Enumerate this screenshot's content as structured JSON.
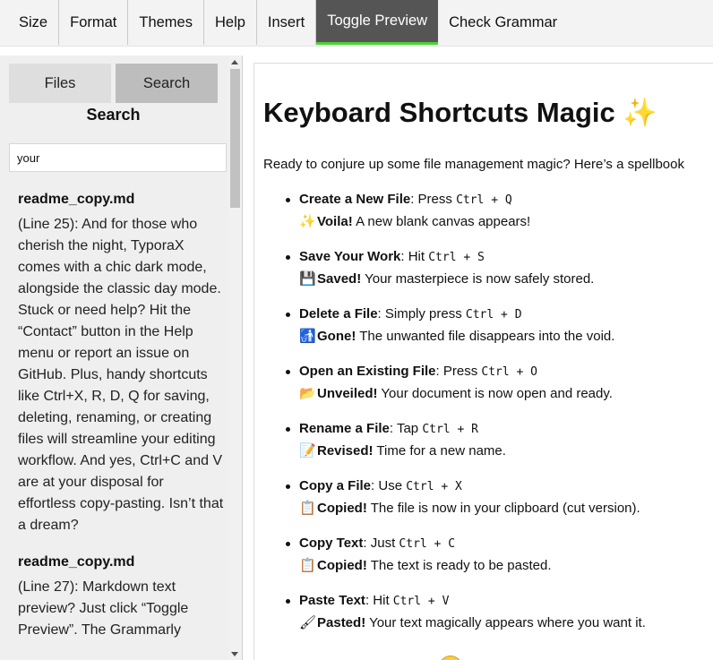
{
  "menu": {
    "items": [
      {
        "label": "Size"
      },
      {
        "label": "Format"
      },
      {
        "label": "Themes"
      },
      {
        "label": "Help"
      },
      {
        "label": "Insert"
      },
      {
        "label": "Toggle Preview",
        "active": true
      },
      {
        "label": "Check Grammar"
      }
    ],
    "active_color": "#555555",
    "active_underline_color": "#4cd137"
  },
  "sidebar": {
    "tabs": [
      {
        "label": "Files"
      },
      {
        "label": "Search",
        "active": true
      }
    ],
    "title": "Search",
    "search_value": "your",
    "results": [
      {
        "file": "readme_copy.md",
        "snippet": "(Line 25): And for those who cherish the night, TyporaX comes with a chic dark mode, alongside the classic day mode. Stuck or need help? Hit the “Contact” button in the Help menu or report an issue on GitHub. Plus, handy shortcuts like Ctrl+X, R, D, Q for saving, deleting, renaming, or creating files will streamline your editing workflow. And yes, Ctrl+C and V are at your disposal for effortless copy-pasting. Isn’t that a dream?"
      },
      {
        "file": "readme_copy.md",
        "snippet": "(Line 27): Markdown text preview? Just click “Toggle Preview”. The Grammarly"
      }
    ]
  },
  "preview": {
    "title": "Keyboard Shortcuts Magic",
    "title_emoji": "✨",
    "intro": "Ready to conjure up some file management magic? Here’s a spellbook",
    "shortcuts": [
      {
        "name": "Create a New File",
        "verb": ": Press ",
        "keys": "Ctrl + Q",
        "emoji": "✨",
        "result": "Voila!",
        "desc": " A new blank canvas appears!"
      },
      {
        "name": "Save Your Work",
        "verb": ": Hit ",
        "keys": "Ctrl + S",
        "emoji": "💾",
        "result": "Saved!",
        "desc": " Your masterpiece is now safely stored."
      },
      {
        "name": "Delete a File",
        "verb": ": Simply press ",
        "keys": "Ctrl + D",
        "emoji": "🚮",
        "result": "Gone!",
        "desc": " The unwanted file disappears into the void."
      },
      {
        "name": "Open an Existing File",
        "verb": ": Press ",
        "keys": "Ctrl + O",
        "emoji": "📂",
        "result": "Unveiled!",
        "desc": " Your document is now open and ready."
      },
      {
        "name": "Rename a File",
        "verb": ": Tap ",
        "keys": "Ctrl + R",
        "emoji": "📝",
        "result": "Revised!",
        "desc": " Time for a new name."
      },
      {
        "name": "Copy a File",
        "verb": ": Use ",
        "keys": "Ctrl + X",
        "emoji": "📋",
        "result": "Copied!",
        "desc": " The file is now in your clipboard (cut version)."
      },
      {
        "name": "Copy Text",
        "verb": ": Just ",
        "keys": "Ctrl + C",
        "emoji": "📋",
        "result": "Copied!",
        "desc": " The text is ready to be pasted."
      },
      {
        "name": "Paste Text",
        "verb": ": Hit ",
        "keys": "Ctrl + V",
        "emoji": "🖌",
        "result": "Pasted!",
        "desc": " Your text magically appears where you want it."
      }
    ]
  }
}
